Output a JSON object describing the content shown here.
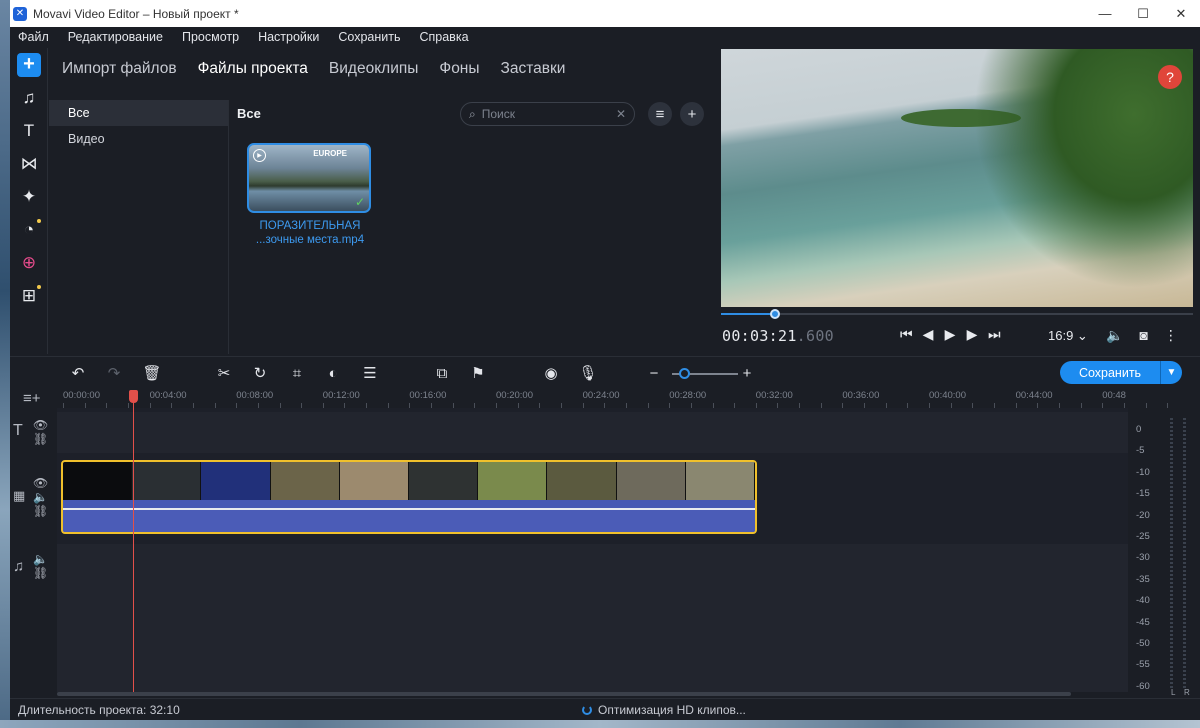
{
  "window": {
    "title": "Movavi Video Editor – Новый проект *",
    "controls": [
      "—",
      "☐",
      "✕"
    ]
  },
  "menu": [
    "Файл",
    "Редактирование",
    "Просмотр",
    "Настройки",
    "Сохранить",
    "Справка"
  ],
  "rail": [
    {
      "icon": "add-icon",
      "glyph": "+"
    },
    {
      "icon": "music-icon",
      "glyph": "♫"
    },
    {
      "icon": "text-icon",
      "glyph": "T"
    },
    {
      "icon": "transitions-icon",
      "glyph": "⋈"
    },
    {
      "icon": "filters-icon",
      "glyph": "✦"
    },
    {
      "icon": "stickers-icon",
      "glyph": "◔",
      "badge": true
    },
    {
      "icon": "callouts-icon",
      "glyph": "⊕"
    },
    {
      "icon": "more-tools-icon",
      "glyph": "⊞",
      "badge": true
    }
  ],
  "import": {
    "tabs": [
      "Импорт файлов",
      "Файлы проекта",
      "Видеоклипы",
      "Фоны",
      "Заставки"
    ],
    "active_tab": 1,
    "categories": [
      "Все",
      "Видео"
    ],
    "files_heading": "Все",
    "search_placeholder": "Поиск",
    "clip": {
      "tag": "EUROPE",
      "name_line1": "ПОРАЗИТЕЛЬНАЯ",
      "name_line2": "...зочные места.mp4"
    }
  },
  "preview": {
    "timecode_main": "00:03:21",
    "timecode_ms": ".600",
    "aspect": "16:9 ⌄",
    "help": "?",
    "progress_fraction": 0.115
  },
  "timeline": {
    "save_label": "Сохранить",
    "ruler": [
      "00:00:00",
      "00:04:00",
      "00:08:00",
      "00:12:00",
      "00:16:00",
      "00:20:00",
      "00:24:00",
      "00:28:00",
      "00:32:00",
      "00:36:00",
      "00:40:00",
      "00:44:00",
      "00:48"
    ],
    "db_scale": [
      "0",
      "-5",
      "-10",
      "-15",
      "-20",
      "-25",
      "-30",
      "-35",
      "-40",
      "-45",
      "-50",
      "-55",
      "-60"
    ],
    "meter_l": "L",
    "meter_r": "R"
  },
  "status": {
    "duration": "Длительность проекта: 32:10",
    "optimizing": "Оптимизация HD клипов..."
  },
  "colors": {
    "accent": "#1d8cf0",
    "playhead": "#e2504a",
    "clip_border": "#f0c02c",
    "audio": "#4b5cb7"
  }
}
